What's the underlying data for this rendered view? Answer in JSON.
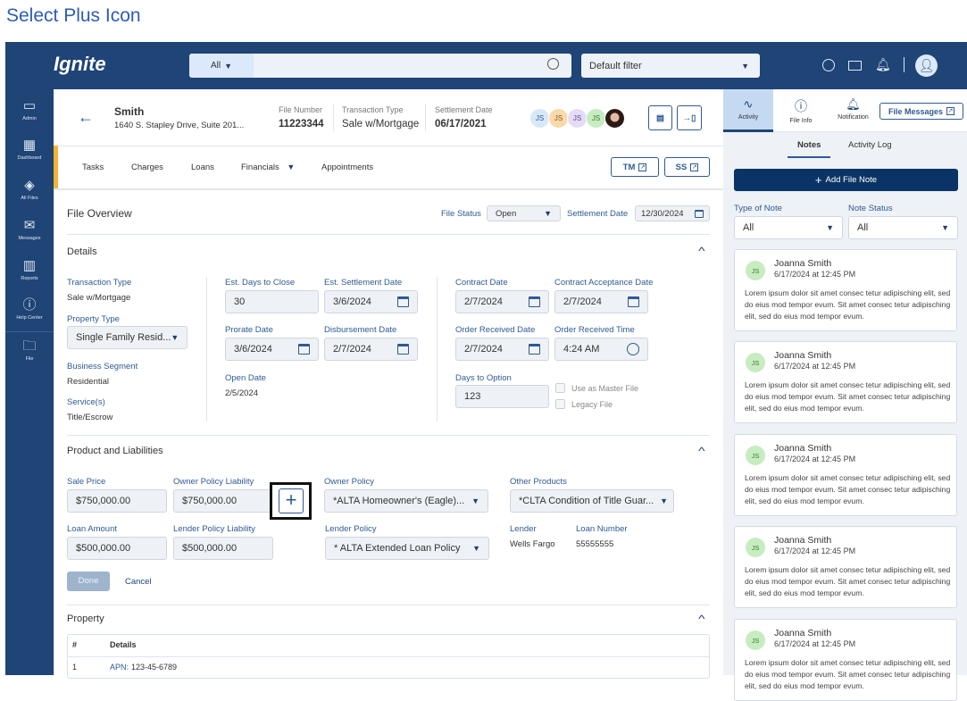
{
  "caption": "Select Plus Icon",
  "topbar": {
    "logo": "Ignite",
    "search_scope": "All",
    "search_placeholder": "",
    "filter": "Default filter"
  },
  "sidebar": {
    "items": [
      {
        "label": "Admin",
        "icon": "laptop-icon"
      },
      {
        "label": "Dashboard",
        "icon": "grid-icon"
      },
      {
        "label": "All Files",
        "icon": "layers-icon"
      },
      {
        "label": "Messages",
        "icon": "mail-icon"
      },
      {
        "label": "Reports",
        "icon": "chart-icon"
      },
      {
        "label": "Help Center",
        "icon": "help-icon"
      },
      {
        "label": "File",
        "icon": "folder-icon"
      }
    ]
  },
  "file_header": {
    "name": "Smith",
    "address": "1640 S. Stapley Drive, Suite 201...",
    "file_number_label": "File Number",
    "file_number": "11223344",
    "transaction_type_label": "Transaction Type",
    "transaction_type": "Sale w/Mortgage",
    "settlement_date_label": "Settlement Date",
    "settlement_date": "06/17/2021",
    "avatars": [
      "JS",
      "JS",
      "JS",
      "JS"
    ]
  },
  "tabs": [
    "Tasks",
    "Charges",
    "Loans",
    "Financials",
    "Appointments"
  ],
  "tab_buttons": [
    "TM",
    "SS"
  ],
  "overview": {
    "title": "File Overview",
    "file_status_label": "File Status",
    "file_status": "Open",
    "settlement_date_label": "Settlement Date",
    "settlement_date": "12/30/2024"
  },
  "details": {
    "title": "Details",
    "transaction_type_label": "Transaction Type",
    "transaction_type": "Sale w/Mortgage",
    "property_type_label": "Property Type",
    "property_type": "Single Family Resid...",
    "business_segment_label": "Business Segment",
    "business_segment": "Residential",
    "services_label": "Service(s)",
    "services": "Title/Escrow",
    "est_days_label": "Est. Days to Close",
    "est_days": "30",
    "est_settlement_label": "Est. Settlement Date",
    "est_settlement": "3/6/2024",
    "prorate_label": "Prorate Date",
    "prorate": "3/6/2024",
    "disbursement_label": "Disbursement Date",
    "disbursement": "2/7/2024",
    "open_date_label": "Open Date",
    "open_date": "2/5/2024",
    "contract_label": "Contract Date",
    "contract": "2/7/2024",
    "contract_accept_label": "Contract Acceptance Date",
    "contract_accept": "2/7/2024",
    "order_date_label": "Order Received Date",
    "order_date": "2/7/2024",
    "order_time_label": "Order Received Time",
    "order_time": "4:24 AM",
    "days_option_label": "Days to Option",
    "days_option": "123",
    "master_file_label": "Use as Master File",
    "legacy_file_label": "Legacy File"
  },
  "products": {
    "title": "Product and Liabilities",
    "sale_price_label": "Sale Price",
    "sale_price": "$750,000.00",
    "owner_liab_label": "Owner Policy Liability",
    "owner_liab": "$750,000.00",
    "owner_policy_label": "Owner Policy",
    "owner_policy": "*ALTA Homeowner's (Eagle)...",
    "other_products_label": "Other Products",
    "other_products": "*CLTA Condition of Title Guar...",
    "loan_amount_label": "Loan Amount",
    "loan_amount": "$500,000.00",
    "lender_liab_label": "Lender Policy Liability",
    "lender_liab": "$500,000.00",
    "lender_policy_label": "Lender Policy",
    "lender_policy": "* ALTA Extended Loan Policy",
    "lender_label": "Lender",
    "lender": "Wells Fargo",
    "loan_number_label": "Loan Number",
    "loan_number": "55555555",
    "done": "Done",
    "cancel": "Cancel"
  },
  "property": {
    "title": "Property",
    "columns": [
      "#",
      "Details"
    ],
    "rows": [
      {
        "num": "1",
        "key": "APN:",
        "value": "123-45-6789"
      }
    ]
  },
  "right_panel": {
    "tabs": [
      "Activity",
      "File Info",
      "Notification"
    ],
    "file_messages": "File Messages",
    "subtabs": [
      "Notes",
      "Activity Log"
    ],
    "add_note": "Add File Note",
    "type_of_note_label": "Type of Note",
    "type_of_note": "All",
    "note_status_label": "Note Status",
    "note_status": "All",
    "notes": [
      {
        "initials": "JS",
        "author": "Joanna Smith",
        "date": "6/17/2024 at 12:45 PM",
        "body": "Lorem ipsum dolor sit amet consec tetur adipisching elit, sed do eius mod tempor evum. Sit amet consec tetur adipisching elit, sed do eius mod tempor evum."
      },
      {
        "initials": "JS",
        "author": "Joanna Smith",
        "date": "6/17/2024 at 12:45 PM",
        "body": "Lorem ipsum dolor sit amet consec tetur adipisching elit, sed do eius mod tempor evum. Sit amet consec tetur adipisching elit, sed do eius mod tempor evum."
      },
      {
        "initials": "JS",
        "author": "Joanna Smith",
        "date": "6/17/2024 at 12:45 PM",
        "body": "Lorem ipsum dolor sit amet consec tetur adipisching elit, sed do eius mod tempor evum. Sit amet consec tetur adipisching elit, sed do eius mod tempor evum."
      },
      {
        "initials": "JS",
        "author": "Joanna Smith",
        "date": "6/17/2024 at 12:45 PM",
        "body": "Lorem ipsum dolor sit amet consec tetur adipisching elit, sed do eius mod tempor evum. Sit amet consec tetur adipisching elit, sed do eius mod tempor evum."
      },
      {
        "initials": "JS",
        "author": "Joanna Smith",
        "date": "6/17/2024 at 12:45 PM",
        "body": "Lorem ipsum dolor sit amet consec tetur adipisching elit, sed do eius mod tempor evum. Sit amet consec tetur adipisching elit, sed do eius mod tempor evum."
      }
    ]
  },
  "colors": {
    "navy": "#1f4476",
    "accent": "#2f5a93",
    "highlight": "#f5b335"
  }
}
